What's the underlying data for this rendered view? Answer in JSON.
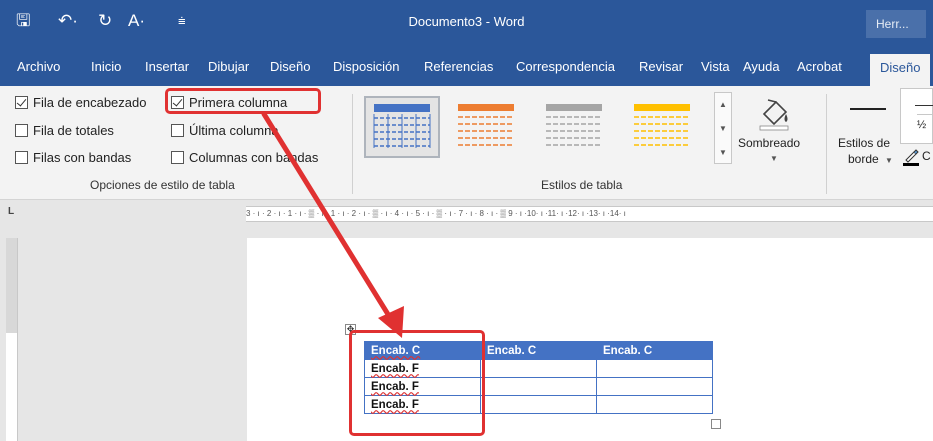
{
  "window": {
    "title": "Documento3 - Word",
    "account_button": "Herr..."
  },
  "quick_access": {
    "save": "🖫",
    "undo": "↶·",
    "redo": "↻",
    "format_painter": "A·",
    "customize": "⩧"
  },
  "tabs": [
    {
      "label": "Archivo"
    },
    {
      "label": "Inicio"
    },
    {
      "label": "Insertar"
    },
    {
      "label": "Dibujar"
    },
    {
      "label": "Diseño"
    },
    {
      "label": "Disposición"
    },
    {
      "label": "Referencias"
    },
    {
      "label": "Correspondencia"
    },
    {
      "label": "Revisar"
    },
    {
      "label": "Vista"
    },
    {
      "label": "Ayuda"
    },
    {
      "label": "Acrobat"
    },
    {
      "label": "Diseño",
      "active": true
    }
  ],
  "table_style_options": {
    "group_label": "Opciones de estilo de tabla",
    "checkboxes": [
      {
        "label": "Fila de encabezado",
        "checked": true
      },
      {
        "label": "Primera columna",
        "checked": true
      },
      {
        "label": "Fila de totales",
        "checked": false
      },
      {
        "label": "Última columna",
        "checked": false
      },
      {
        "label": "Filas con bandas",
        "checked": false
      },
      {
        "label": "Columnas con bandas",
        "checked": false
      }
    ]
  },
  "table_styles": {
    "group_label": "Estilos de tabla",
    "colors": [
      "#4472c4",
      "#ed7d31",
      "#a5a5a5",
      "#ffc000"
    ],
    "shading_label": "Sombreado"
  },
  "borders": {
    "label_line1": "Estilos de",
    "label_line2": "borde",
    "weight": "½",
    "pen_color_fragment": "C"
  },
  "ruler": {
    "text": "3 · ı · 2 · ı · 1 · ı · ▒ · ı · 1 · ı · 2 · ı · ▒ · ı · 4 · ı · 5 · ı · ▒ · ı · 7 · ı · 8 · ı · ▒ 9 · ı ·10· ı ·11· ı ·12· ı ·13· ı ·14· ı"
  },
  "document_table": {
    "header": [
      "Encab. C",
      "Encab. C",
      "Encab. C"
    ],
    "rows": [
      [
        "Encab. F",
        "",
        ""
      ],
      [
        "Encab. F",
        "",
        ""
      ],
      [
        "Encab. F",
        "",
        ""
      ]
    ]
  },
  "annotation": {
    "color": "#e03131"
  }
}
